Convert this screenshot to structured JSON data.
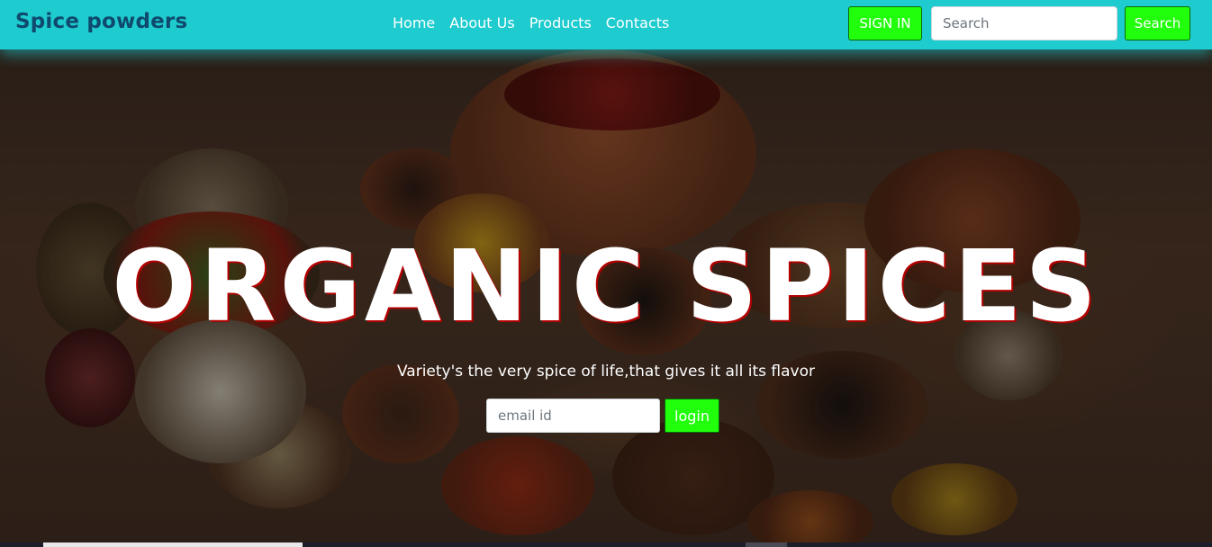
{
  "navbar": {
    "brand": "Spice powders",
    "links": [
      "Home",
      "About Us",
      "Products",
      "Contacts"
    ],
    "signin_label": "SIGN IN",
    "search_placeholder": "Search",
    "search_button": "Search"
  },
  "hero": {
    "title": "ORGANIC SPICES",
    "subtitle": "Variety's the very spice of life,that gives it all its flavor",
    "email_placeholder": "email id",
    "login_label": "login"
  },
  "colors": {
    "navbar_bg": "#1ecbcf",
    "brand_text": "#0f4a6e",
    "button_green": "#22ff0c",
    "title_shadow": "#b30000"
  }
}
